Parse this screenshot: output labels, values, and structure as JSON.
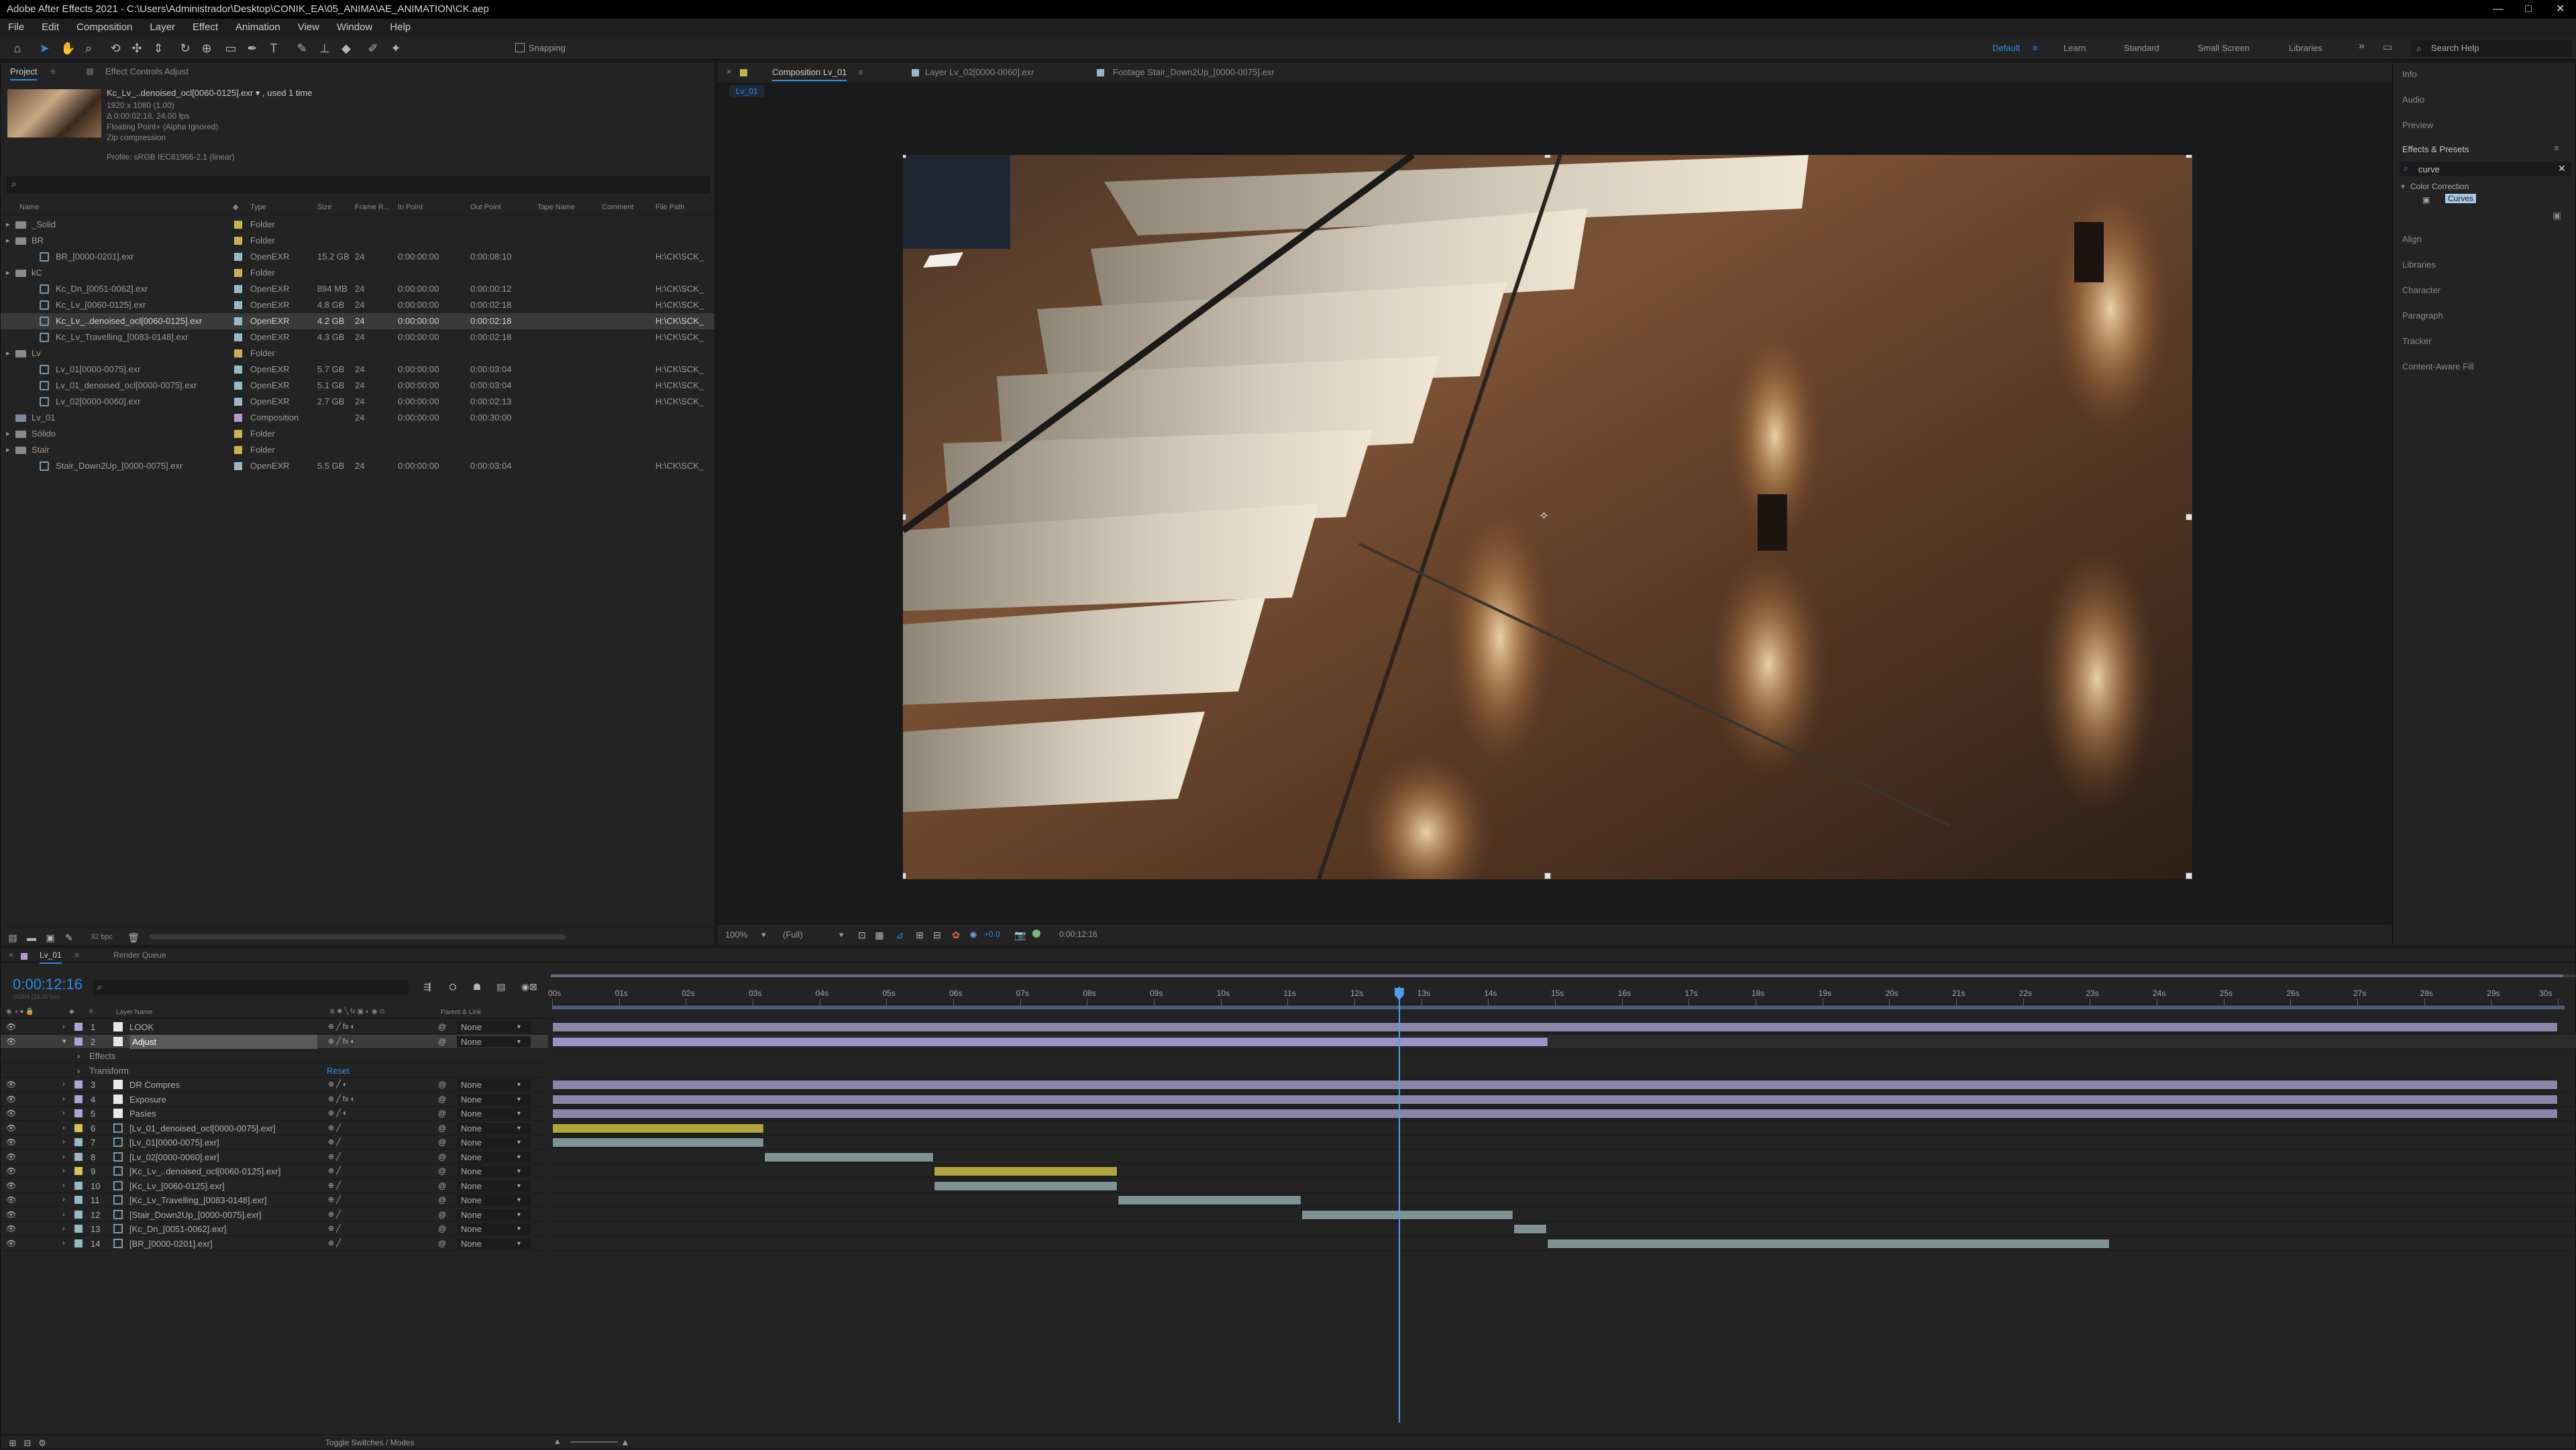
{
  "app": {
    "title": "Adobe After Effects 2021 - C:\\Users\\Administrador\\Desktop\\CONIK_EA\\05_ANIMA\\AE_ANIMATION\\CK.aep",
    "minimize": "—",
    "maximize": "□",
    "close": "✕"
  },
  "menu": [
    "File",
    "Edit",
    "Composition",
    "Layer",
    "Effect",
    "Animation",
    "View",
    "Window",
    "Help"
  ],
  "toolbar": {
    "snapping": "Snapping",
    "workspaces": [
      "Default",
      "Learn",
      "Standard",
      "Small Screen",
      "Libraries"
    ],
    "search_help": "Search Help"
  },
  "project": {
    "tabs": [
      "Project",
      "Effect Controls Adjust"
    ],
    "selected_item": {
      "name": "Kc_Lv_..denoised_ocl[0060-0125].exr",
      "used": ", used 1 time",
      "info": [
        "1920 x 1080 (1.00)",
        "Δ 0:00:02:18, 24.00 fps",
        "Floating Point+ (Alpha Ignored)",
        "Zip compression"
      ],
      "profile": "Profile: sRGB IEC61966-2.1 (linear)"
    },
    "columns": [
      "Name",
      "Type",
      "Size",
      "Frame R...",
      "In Point",
      "Out Point",
      "Tape Name",
      "Comment",
      "File Path"
    ],
    "rows": [
      {
        "indent": 0,
        "kind": "folder",
        "name": "_Solid",
        "label": "#c8b34a",
        "type": "Folder",
        "size": "",
        "fr": "",
        "in": "",
        "out": "",
        "path": ""
      },
      {
        "indent": 0,
        "kind": "folder",
        "name": "BR",
        "label": "#c8b34a",
        "type": "Folder",
        "size": "",
        "fr": "",
        "in": "",
        "out": "",
        "path": ""
      },
      {
        "indent": 1,
        "kind": "file",
        "name": "BR_[0000-0201].exr",
        "label": "#9ab8c4",
        "type": "OpenEXR",
        "size": "15.2 GB",
        "fr": "24",
        "in": "0:00:00:00",
        "out": "0:00:08:10",
        "path": "H:\\CK\\SCK_"
      },
      {
        "indent": 0,
        "kind": "folder",
        "name": "kC",
        "label": "#c8b34a",
        "type": "Folder",
        "size": "",
        "fr": "",
        "in": "",
        "out": "",
        "path": ""
      },
      {
        "indent": 1,
        "kind": "file",
        "name": "Kc_Dn_[0051-0062].exr",
        "label": "#9ab8c4",
        "type": "OpenEXR",
        "size": "894 MB",
        "fr": "24",
        "in": "0:00:00:00",
        "out": "0:00:00:12",
        "path": "H:\\CK\\SCK_"
      },
      {
        "indent": 1,
        "kind": "file",
        "name": "Kc_Lv_[0060-0125].exr",
        "label": "#9ab8c4",
        "type": "OpenEXR",
        "size": "4.8 GB",
        "fr": "24",
        "in": "0:00:00:00",
        "out": "0:00:02:18",
        "path": "H:\\CK\\SCK_"
      },
      {
        "indent": 1,
        "kind": "file",
        "name": "Kc_Lv_..denoised_ocl[0060-0125].exr",
        "label": "#9ab8c4",
        "type": "OpenEXR",
        "size": "4.2 GB",
        "fr": "24",
        "in": "0:00:00:00",
        "out": "0:00:02:18",
        "path": "H:\\CK\\SCK_",
        "selected": true
      },
      {
        "indent": 1,
        "kind": "file",
        "name": "Kc_Lv_Travelling_[0083-0148].exr",
        "label": "#9ab8c4",
        "type": "OpenEXR",
        "size": "4.3 GB",
        "fr": "24",
        "in": "0:00:00:00",
        "out": "0:00:02:18",
        "path": "H:\\CK\\SCK_"
      },
      {
        "indent": 0,
        "kind": "folder",
        "name": "Lv",
        "label": "#c8b34a",
        "type": "Folder",
        "size": "",
        "fr": "",
        "in": "",
        "out": "",
        "path": ""
      },
      {
        "indent": 1,
        "kind": "file",
        "name": "Lv_01[0000-0075].exr",
        "label": "#9ab8c4",
        "type": "OpenEXR",
        "size": "5.7 GB",
        "fr": "24",
        "in": "0:00:00:00",
        "out": "0:00:03:04",
        "path": "H:\\CK\\SCK_"
      },
      {
        "indent": 1,
        "kind": "file",
        "name": "Lv_01_denoised_ocl[0000-0075].exr",
        "label": "#9ab8c4",
        "type": "OpenEXR",
        "size": "5.1 GB",
        "fr": "24",
        "in": "0:00:00:00",
        "out": "0:00:03:04",
        "path": "H:\\CK\\SCK_"
      },
      {
        "indent": 1,
        "kind": "file",
        "name": "Lv_02[0000-0060].exr",
        "label": "#9ab8c4",
        "type": "OpenEXR",
        "size": "2.7 GB",
        "fr": "24",
        "in": "0:00:00:00",
        "out": "0:00:02:13",
        "path": "H:\\CK\\SCK_"
      },
      {
        "indent": 0,
        "kind": "comp",
        "name": "Lv_01",
        "label": "#b39ad6",
        "type": "Composition",
        "size": "",
        "fr": "24",
        "in": "0:00:00:00",
        "out": "0:00:30:00",
        "path": ""
      },
      {
        "indent": 0,
        "kind": "folder",
        "name": "Sólido",
        "label": "#c8b34a",
        "type": "Folder",
        "size": "",
        "fr": "",
        "in": "",
        "out": "",
        "path": ""
      },
      {
        "indent": 0,
        "kind": "folder",
        "name": "Stair",
        "label": "#c8b34a",
        "type": "Folder",
        "size": "",
        "fr": "",
        "in": "",
        "out": "",
        "path": ""
      },
      {
        "indent": 1,
        "kind": "file",
        "name": "Stair_Down2Up_[0000-0075].exr",
        "label": "#9ab8c4",
        "type": "OpenEXR",
        "size": "5.5 GB",
        "fr": "24",
        "in": "0:00:00:00",
        "out": "0:00:03:04",
        "path": "H:\\CK\\SCK_"
      }
    ],
    "bpc": "32 bpc"
  },
  "composition": {
    "tabs": [
      "Composition Lv_01",
      "Layer Lv_02[0000-0060].exr",
      "Footage Stair_Down2Up_[0000-0075].exr"
    ],
    "subtab": "Lv_01",
    "zoom": "100%",
    "resolution": "(Full)",
    "exposure": "+0.0",
    "timecode": "0:00:12:16"
  },
  "right_panel": {
    "items_top": [
      "Info",
      "Audio",
      "Preview"
    ],
    "effects_title": "Effects & Presets",
    "effects_search": "curve",
    "category": "Color Correction",
    "result": "Curves",
    "items_bottom": [
      "Align",
      "Libraries",
      "Character",
      "Paragraph",
      "Tracker",
      "Content-Aware Fill"
    ]
  },
  "timeline": {
    "tabs": [
      "Lv_01",
      "Render Queue"
    ],
    "timecode": "0:00:12:16",
    "frames": "00304 (24.00 fps)",
    "header_layer_name": "Layer Name",
    "header_parent": "Parent & Link",
    "ruler": [
      "00s",
      "01s",
      "02s",
      "03s",
      "04s",
      "05s",
      "06s",
      "07s",
      "08s",
      "09s",
      "10s",
      "11s",
      "12s",
      "13s",
      "14s",
      "15s",
      "16s",
      "17s",
      "18s",
      "19s",
      "20s",
      "21s",
      "22s",
      "23s",
      "24s",
      "25s",
      "26s",
      "27s",
      "28s",
      "29s",
      "30s"
    ],
    "duration_seconds": 30,
    "current_seconds": 12.67,
    "layers": [
      {
        "num": "1",
        "name": "LOOK",
        "label": "#a8a8d8",
        "kind": "solid",
        "parent": "None",
        "bar": [
          0,
          30
        ],
        "bar_color": "#8a86a8"
      },
      {
        "num": "2",
        "name": "Adjust",
        "label": "#a8a8d8",
        "kind": "solid",
        "parent": "None",
        "bar": [
          0,
          14.9
        ],
        "bar_color": "#9a94c8",
        "selected": true
      },
      {
        "num": "",
        "name": "Effects",
        "sub": true,
        "reset": ""
      },
      {
        "num": "",
        "name": "Transform",
        "sub": true,
        "reset": "Reset"
      },
      {
        "num": "3",
        "name": "DR Compres",
        "label": "#a8a8d8",
        "kind": "solid",
        "parent": "None",
        "bar": [
          0,
          30
        ],
        "bar_color": "#8a86a8"
      },
      {
        "num": "4",
        "name": "Exposure",
        "label": "#a8a8d8",
        "kind": "solid",
        "parent": "None",
        "bar": [
          0,
          30
        ],
        "bar_color": "#8a86a8"
      },
      {
        "num": "5",
        "name": "Pasíes",
        "label": "#a8a8d8",
        "kind": "solid",
        "parent": "None",
        "bar": [
          0,
          30
        ],
        "bar_color": "#8a86a8"
      },
      {
        "num": "6",
        "name": "[Lv_01_denoised_ocl[0000-0075].exr]",
        "label": "#d6c45a",
        "kind": "file",
        "parent": "None",
        "bar": [
          0,
          3.17
        ],
        "bar_color": "#b4a63e"
      },
      {
        "num": "7",
        "name": "[Lv_01[0000-0075].exr]",
        "label": "#9ab8c4",
        "kind": "file",
        "parent": "None",
        "bar": [
          0,
          3.17
        ],
        "bar_color": "#7f9294"
      },
      {
        "num": "8",
        "name": "[Lv_02[0000-0060].exr]",
        "label": "#9ab8c4",
        "kind": "file",
        "parent": "None",
        "bar": [
          3.17,
          5.71
        ],
        "bar_color": "#7f9294"
      },
      {
        "num": "9",
        "name": "[Kc_Lv_..denoised_ocl[0060-0125].exr]",
        "label": "#d6c45a",
        "kind": "file",
        "parent": "None",
        "bar": [
          5.71,
          8.46
        ],
        "bar_color": "#b4a63e"
      },
      {
        "num": "10",
        "name": "[Kc_Lv_[0060-0125].exr]",
        "label": "#9ab8c4",
        "kind": "file",
        "parent": "None",
        "bar": [
          5.71,
          8.46
        ],
        "bar_color": "#7f9294"
      },
      {
        "num": "11",
        "name": "[Kc_Lv_Travelling_[0083-0148].exr]",
        "label": "#9ab8c4",
        "kind": "file",
        "parent": "None",
        "bar": [
          8.46,
          11.21
        ],
        "bar_color": "#7f9294"
      },
      {
        "num": "12",
        "name": "[Stair_Down2Up_[0000-0075].exr]",
        "label": "#9ab8c4",
        "kind": "file",
        "parent": "None",
        "bar": [
          11.21,
          14.38
        ],
        "bar_color": "#7f9294"
      },
      {
        "num": "13",
        "name": "[Kc_Dn_[0051-0062].exr]",
        "label": "#9ab8c4",
        "kind": "file",
        "parent": "None",
        "bar": [
          14.38,
          14.88
        ],
        "bar_color": "#7f9294"
      },
      {
        "num": "14",
        "name": "[BR_[0000-0201].exr]",
        "label": "#9ab8c4",
        "kind": "file",
        "parent": "None",
        "bar": [
          14.88,
          23.3
        ],
        "bar_color": "#7f9294"
      }
    ],
    "footer": "Toggle Switches / Modes"
  },
  "colors": {
    "accent": "#2d8ceb",
    "playhead": "#4aa0f0",
    "work_area": "#4a6aa8"
  }
}
